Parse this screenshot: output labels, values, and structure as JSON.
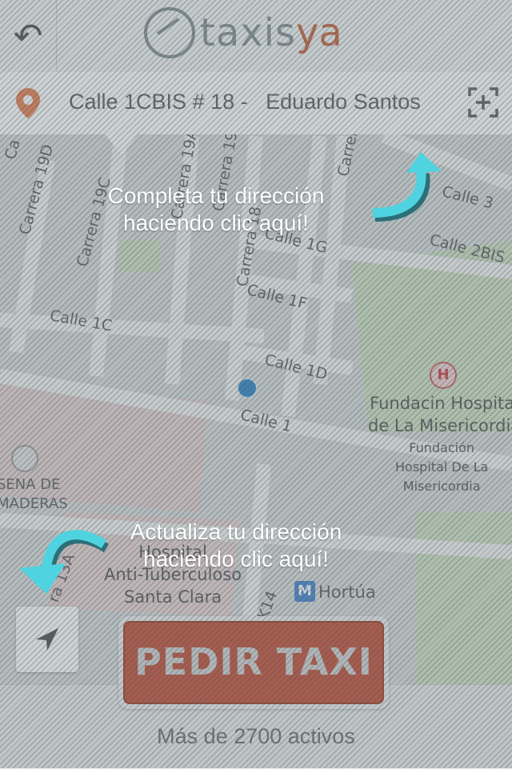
{
  "header": {
    "logo_text_main": "taxis",
    "logo_text_accent": "ya"
  },
  "address_bar": {
    "address": "Calle 1CBIS # 18 -   Eduardo Santos"
  },
  "tips": {
    "top": [
      "Completa tu dirección",
      "haciendo clic aquí!"
    ],
    "bottom": [
      "Actualiza tu dirección",
      "haciendo clic aquí!"
    ]
  },
  "map_labels": {
    "streets": [
      "Carrera 19D",
      "Carrera 19C",
      "Calle 1C",
      "Calle 1G",
      "Calle 1F",
      "Calle 1D",
      "Calle 1",
      "Calle 3",
      "Calle 2BIS",
      "Carrera 19",
      "Carrera 19A",
      "Carrera 18",
      "Carrera",
      "K14",
      "ra 13A",
      "Ca"
    ],
    "pois": {
      "hospital_name": [
        "Fundacin Hospital",
        "de La Misericordia"
      ],
      "hospital_sub": [
        "Fundación",
        "Hospital De La",
        "Misericordia"
      ],
      "sena": [
        "SENA DE",
        "MADERAS"
      ],
      "hospital2": [
        "Hospital",
        "Anti-Tuberculoso",
        "Santa Clara"
      ],
      "metro": "Hortúa"
    }
  },
  "buttons": {
    "pedir_taxi": "PEDIR TAXI"
  },
  "footer": {
    "activos": "Más de 2700 activos"
  },
  "colors": {
    "accent": "#c0442a",
    "pin": "#e8794a",
    "arrow": "#4fd3e0"
  }
}
